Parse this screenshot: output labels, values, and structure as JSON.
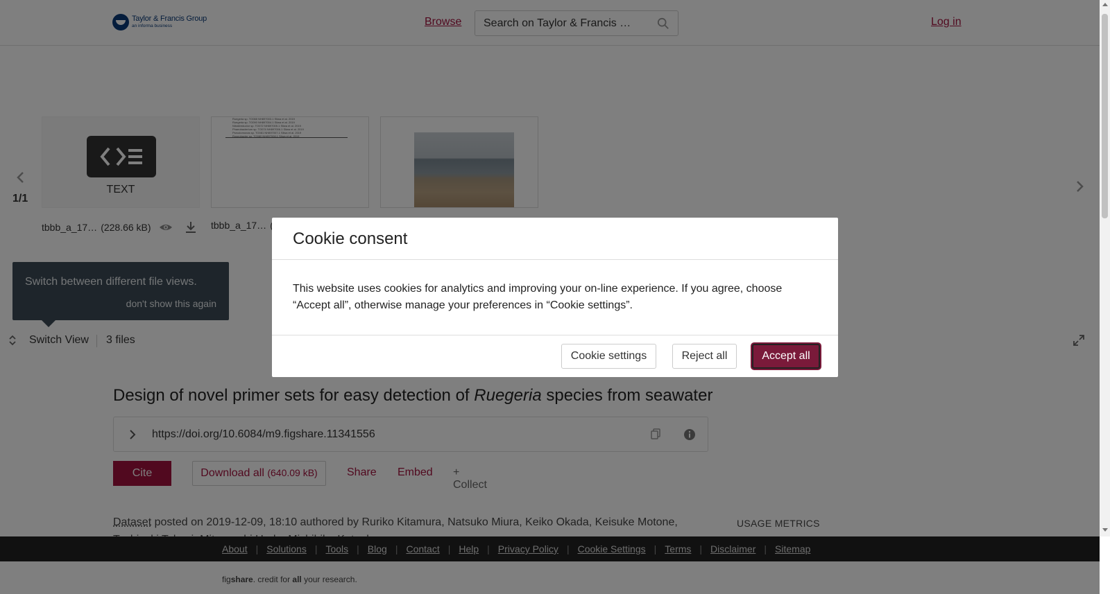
{
  "header": {
    "logo_title": "Taylor & Francis Group",
    "logo_sub": "an informa business",
    "browse_label": "Browse",
    "search_placeholder": "Search on Taylor & Francis …",
    "login_label": "Log in"
  },
  "carousel": {
    "pager": "1/1",
    "files": [
      {
        "type_label": "TEXT",
        "name": "tbbb_a_17…",
        "size": "(228.66 kB)"
      },
      {
        "name": "tbbb_a_17…",
        "size_visible": "("
      },
      {
        "name": ""
      }
    ],
    "table_rows": [
      "Ruegeria sp. TO088     NH897003.1        Sliwa et al. 2019",
      "Ruegeria sp. TO090     NH897004.1        Sliwa et al. 2019",
      "Nitratireductor sp. TO072     NH897005.1        Sliwa et al. 2019",
      "Phaeobacterium sp. TO074     NH897006.1        Sliwa et al. 2019",
      "Pseudomonas sp. TO081     NH897007.1        Sliwa et al. 2019",
      "Roseobacter sp. TO080     NH897008.1        Sliwa et al. 2019"
    ],
    "tooltip_text": "Switch between different file views.",
    "tooltip_dismiss": "don't show this again",
    "switch_view_label": "Switch View",
    "files_count": "3 files"
  },
  "article": {
    "title_before": "Design of novel primer sets for easy detection of ",
    "title_italic": "Ruegeria",
    "title_after": " species from seawater",
    "doi_url": "https://doi.org/10.6084/m9.figshare.11341556",
    "cite_label": "Cite",
    "download_label": "Download all",
    "download_size": "(640.09 kB)",
    "share_label": "Share",
    "embed_label": "Embed",
    "collect_label": "+ Collect",
    "dataset_type": "Dataset",
    "meta_text": " posted on 2019-12-09, 18:10 authored by Ruriko Kitamura, Natsuko Miura, Keiko Okada, Keisuke Motone,",
    "meta_text_cut": "Toshiyuki Takagi, Mitsuyoshi Ueda, Michihiko Kataoka",
    "usage_metrics": "USAGE METRICS"
  },
  "footer": {
    "links": [
      "About",
      "Solutions",
      "Tools",
      "Blog",
      "Contact",
      "Help",
      "Privacy Policy",
      "Cookie Settings",
      "Terms",
      "Disclaimer",
      "Sitemap"
    ],
    "tagline_pre": "fig",
    "tagline_bold": "share",
    "tagline_mid": ". credit for ",
    "tagline_bold2": "all",
    "tagline_end": " your research."
  },
  "cookie_modal": {
    "title": "Cookie consent",
    "body": "This website uses cookies for analytics and improving your on-line experience. If you agree, choose “Accept all”, otherwise manage your preferences in “Cookie settings”.",
    "settings_label": "Cookie settings",
    "reject_label": "Reject all",
    "accept_label": "Accept all"
  },
  "colors": {
    "accent": "#a3133f",
    "accept_button": "#7a1a3a",
    "tooltip_bg": "#3c4a56",
    "footer_bg": "#222222"
  },
  "icons": [
    "search-icon",
    "chevron-left-icon",
    "chevron-right-icon",
    "code-icon",
    "eye-icon",
    "download-icon",
    "switch-view-icon",
    "expand-icon",
    "chevron-right-icon",
    "copy-icon",
    "info-icon"
  ]
}
